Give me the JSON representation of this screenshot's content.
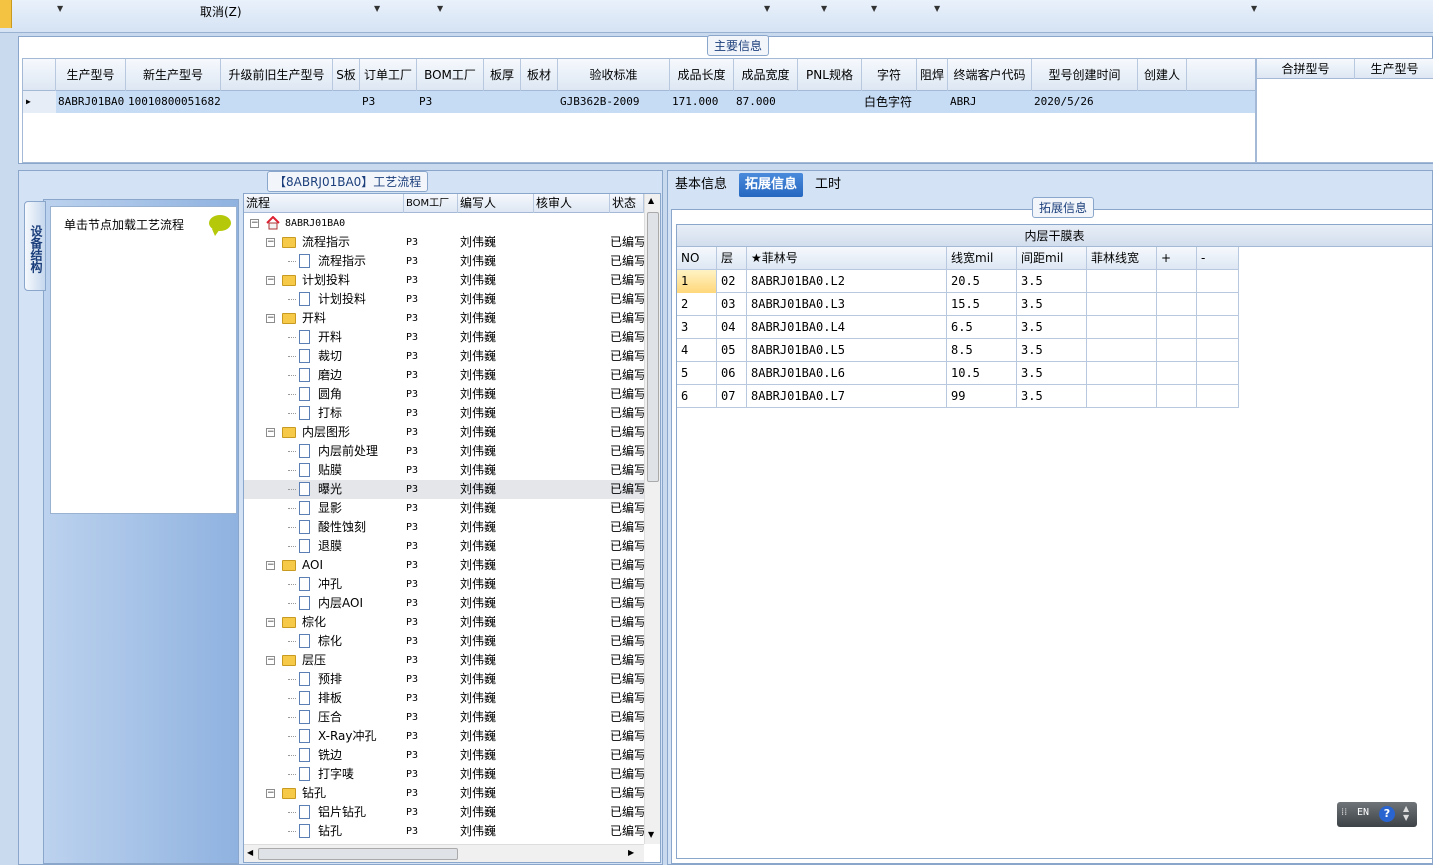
{
  "toolbar": {
    "cancel_label": "取消(Z)"
  },
  "main_info": {
    "title": "主要信息",
    "columns": [
      "生产型号",
      "新生产型号",
      "升级前旧生产型号",
      "S板",
      "订单工厂",
      "BOM工厂",
      "板厚",
      "板材",
      "验收标准",
      "成品长度",
      "成品宽度",
      "PNL规格",
      "字符",
      "阻焊",
      "终端客户代码",
      "型号创建时间",
      "创建人"
    ],
    "row": [
      "8ABRJ01BA0",
      "10010800051682",
      "",
      "",
      "P3",
      "P3",
      "",
      "",
      "GJB362B-2009",
      "171.000",
      "87.000",
      "",
      "白色字符",
      "",
      "ABRJ",
      "2020/5/26",
      ""
    ],
    "merge_columns": [
      "合拼型号",
      "生产型号"
    ]
  },
  "flow": {
    "title": "【8ABRJ01BA0】工艺流程",
    "side_tab": "设备结构",
    "hint": "单击节点加载工艺流程",
    "columns": [
      "流程",
      "BOM工厂",
      "编写人",
      "核审人",
      "状态"
    ],
    "root": "8ABRJ01BA0",
    "rows": [
      {
        "name": "流程指示",
        "level": 1,
        "bom": "P3",
        "writer": "刘伟巍",
        "status": "已编写"
      },
      {
        "name": "流程指示",
        "level": 2,
        "bom": "P3",
        "writer": "刘伟巍",
        "status": "已编写"
      },
      {
        "name": "计划投料",
        "level": 1,
        "bom": "P3",
        "writer": "刘伟巍",
        "status": "已编写"
      },
      {
        "name": "计划投料",
        "level": 2,
        "bom": "P3",
        "writer": "刘伟巍",
        "status": "已编写"
      },
      {
        "name": "开料",
        "level": 1,
        "bom": "P3",
        "writer": "刘伟巍",
        "status": "已编写"
      },
      {
        "name": "开料",
        "level": 2,
        "bom": "P3",
        "writer": "刘伟巍",
        "status": "已编写"
      },
      {
        "name": "裁切",
        "level": 2,
        "bom": "P3",
        "writer": "刘伟巍",
        "status": "已编写"
      },
      {
        "name": "磨边",
        "level": 2,
        "bom": "P3",
        "writer": "刘伟巍",
        "status": "已编写"
      },
      {
        "name": "圆角",
        "level": 2,
        "bom": "P3",
        "writer": "刘伟巍",
        "status": "已编写"
      },
      {
        "name": "打标",
        "level": 2,
        "bom": "P3",
        "writer": "刘伟巍",
        "status": "已编写"
      },
      {
        "name": "内层图形",
        "level": 1,
        "bom": "P3",
        "writer": "刘伟巍",
        "status": "已编写"
      },
      {
        "name": "内层前处理",
        "level": 2,
        "bom": "P3",
        "writer": "刘伟巍",
        "status": "已编写"
      },
      {
        "name": "贴膜",
        "level": 2,
        "bom": "P3",
        "writer": "刘伟巍",
        "status": "已编写"
      },
      {
        "name": "曝光",
        "level": 2,
        "bom": "P3",
        "writer": "刘伟巍",
        "status": "已编写",
        "selected": true
      },
      {
        "name": "显影",
        "level": 2,
        "bom": "P3",
        "writer": "刘伟巍",
        "status": "已编写"
      },
      {
        "name": "酸性蚀刻",
        "level": 2,
        "bom": "P3",
        "writer": "刘伟巍",
        "status": "已编写"
      },
      {
        "name": "退膜",
        "level": 2,
        "bom": "P3",
        "writer": "刘伟巍",
        "status": "已编写"
      },
      {
        "name": "AOI",
        "level": 1,
        "bom": "P3",
        "writer": "刘伟巍",
        "status": "已编写"
      },
      {
        "name": "冲孔",
        "level": 2,
        "bom": "P3",
        "writer": "刘伟巍",
        "status": "已编写"
      },
      {
        "name": "内层AOI",
        "level": 2,
        "bom": "P3",
        "writer": "刘伟巍",
        "status": "已编写"
      },
      {
        "name": "棕化",
        "level": 1,
        "bom": "P3",
        "writer": "刘伟巍",
        "status": "已编写"
      },
      {
        "name": "棕化",
        "level": 2,
        "bom": "P3",
        "writer": "刘伟巍",
        "status": "已编写"
      },
      {
        "name": "层压",
        "level": 1,
        "bom": "P3",
        "writer": "刘伟巍",
        "status": "已编写"
      },
      {
        "name": "预排",
        "level": 2,
        "bom": "P3",
        "writer": "刘伟巍",
        "status": "已编写"
      },
      {
        "name": "排板",
        "level": 2,
        "bom": "P3",
        "writer": "刘伟巍",
        "status": "已编写"
      },
      {
        "name": "压合",
        "level": 2,
        "bom": "P3",
        "writer": "刘伟巍",
        "status": "已编写"
      },
      {
        "name": "X-Ray冲孔",
        "level": 2,
        "bom": "P3",
        "writer": "刘伟巍",
        "status": "已编写"
      },
      {
        "name": "铣边",
        "level": 2,
        "bom": "P3",
        "writer": "刘伟巍",
        "status": "已编写"
      },
      {
        "name": "打字唛",
        "level": 2,
        "bom": "P3",
        "writer": "刘伟巍",
        "status": "已编写"
      },
      {
        "name": "钻孔",
        "level": 1,
        "bom": "P3",
        "writer": "刘伟巍",
        "status": "已编写"
      },
      {
        "name": "铝片钻孔",
        "level": 2,
        "bom": "P3",
        "writer": "刘伟巍",
        "status": "已编写"
      },
      {
        "name": "钻孔",
        "level": 2,
        "bom": "P3",
        "writer": "刘伟巍",
        "status": "已编写"
      }
    ]
  },
  "right": {
    "tabs": [
      "基本信息",
      "拓展信息",
      "工时"
    ],
    "active_tab": 1,
    "group_title": "拓展信息",
    "film": {
      "title": "内层干膜表",
      "columns": [
        "NO",
        "层",
        "★菲林号",
        "线宽mil",
        "间距mil",
        "菲林线宽",
        "+",
        "-"
      ],
      "rows": [
        [
          "1",
          "02",
          "8ABRJ01BA0.L2",
          "20.5",
          "3.5",
          "",
          "",
          ""
        ],
        [
          "2",
          "03",
          "8ABRJ01BA0.L3",
          "15.5",
          "3.5",
          "",
          "",
          ""
        ],
        [
          "3",
          "04",
          "8ABRJ01BA0.L4",
          "6.5",
          "3.5",
          "",
          "",
          ""
        ],
        [
          "4",
          "05",
          "8ABRJ01BA0.L5",
          "8.5",
          "3.5",
          "",
          "",
          ""
        ],
        [
          "5",
          "06",
          "8ABRJ01BA0.L6",
          "10.5",
          "3.5",
          "",
          "",
          ""
        ],
        [
          "6",
          "07",
          "8ABRJ01BA0.L7",
          "99",
          "3.5",
          "",
          "",
          ""
        ]
      ]
    }
  },
  "ime": {
    "lang": "EN",
    "help": "?"
  }
}
